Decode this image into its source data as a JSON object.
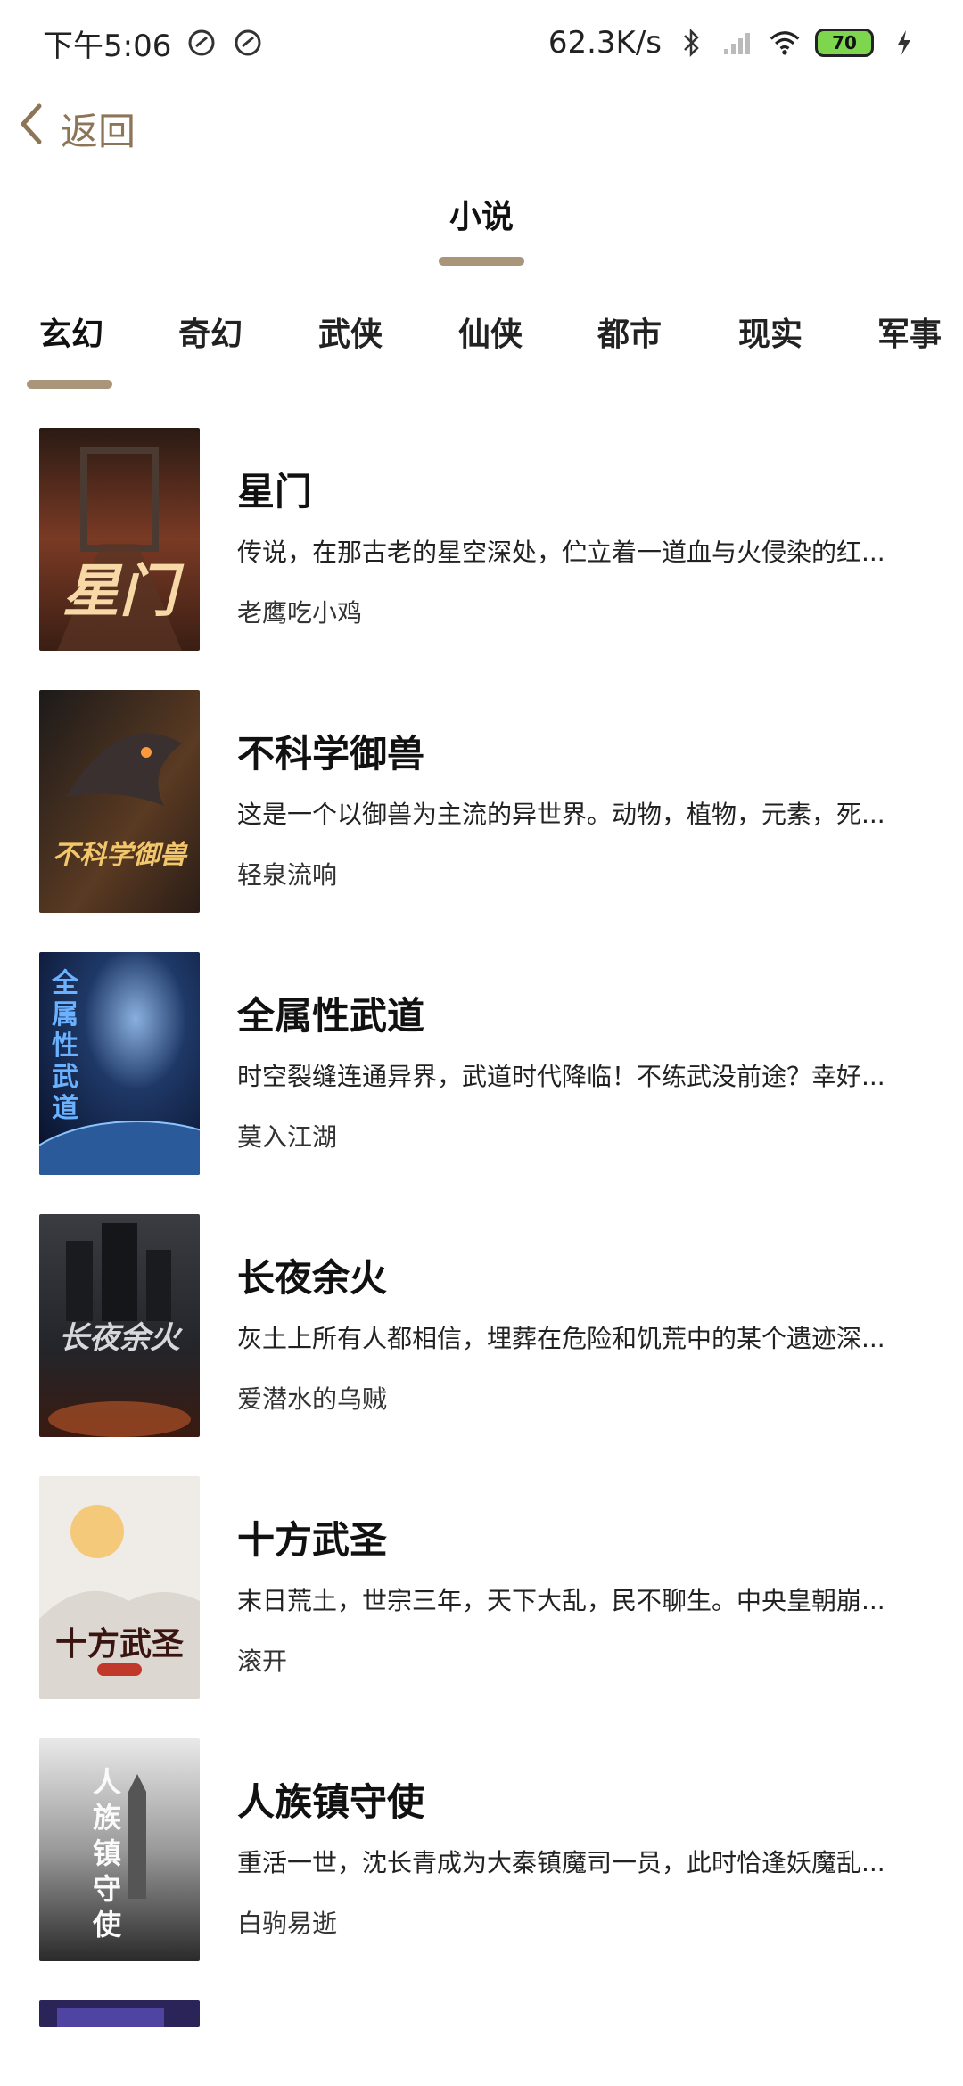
{
  "status_bar": {
    "time": "下午5:06",
    "network_speed": "62.3K/s",
    "battery": "70",
    "icons": [
      "notification-icon",
      "notification-icon",
      "bluetooth-icon",
      "signal-icon",
      "wifi-icon",
      "battery-icon",
      "charging-icon"
    ]
  },
  "header": {
    "back_label": "返回"
  },
  "main_tab": {
    "label": "小说"
  },
  "categories": [
    {
      "label": "玄幻",
      "active": true
    },
    {
      "label": "奇幻"
    },
    {
      "label": "武侠"
    },
    {
      "label": "仙侠"
    },
    {
      "label": "都市"
    },
    {
      "label": "现实"
    },
    {
      "label": "军事"
    }
  ],
  "colors": {
    "accent": "#a8957a",
    "back": "#8c7657",
    "battery": "#7dd64e"
  },
  "books": [
    {
      "title": "星门",
      "description": "传说，在那古老的星空深处，伫立着一道血与火侵染的红...",
      "author": "老鹰吃小鸡",
      "cover_text": "星门"
    },
    {
      "title": "不科学御兽",
      "description": "这是一个以御兽为主流的异世界。动物，植物，元素，死...",
      "author": "轻泉流响",
      "cover_text": "不科学御兽"
    },
    {
      "title": "全属性武道",
      "description": "时空裂缝连通异界，武道时代降临！不练武没前途？幸好...",
      "author": "莫入江湖",
      "cover_text": "全属性武道"
    },
    {
      "title": "长夜余火",
      "description": "灰土上所有人都相信，埋葬在危险和饥荒中的某个遗迹深...",
      "author": "爱潜水的乌贼",
      "cover_text": "长夜余火"
    },
    {
      "title": "十方武圣",
      "description": "末日荒土，世宗三年，天下大乱，民不聊生。中央皇朝崩...",
      "author": "滚开",
      "cover_text": "十方武圣"
    },
    {
      "title": "人族镇守使",
      "description": "重活一世，沈长青成为大秦镇魔司一员，此时恰逢妖魔乱...",
      "author": "白驹易逝",
      "cover_text": "人族镇守使"
    }
  ]
}
